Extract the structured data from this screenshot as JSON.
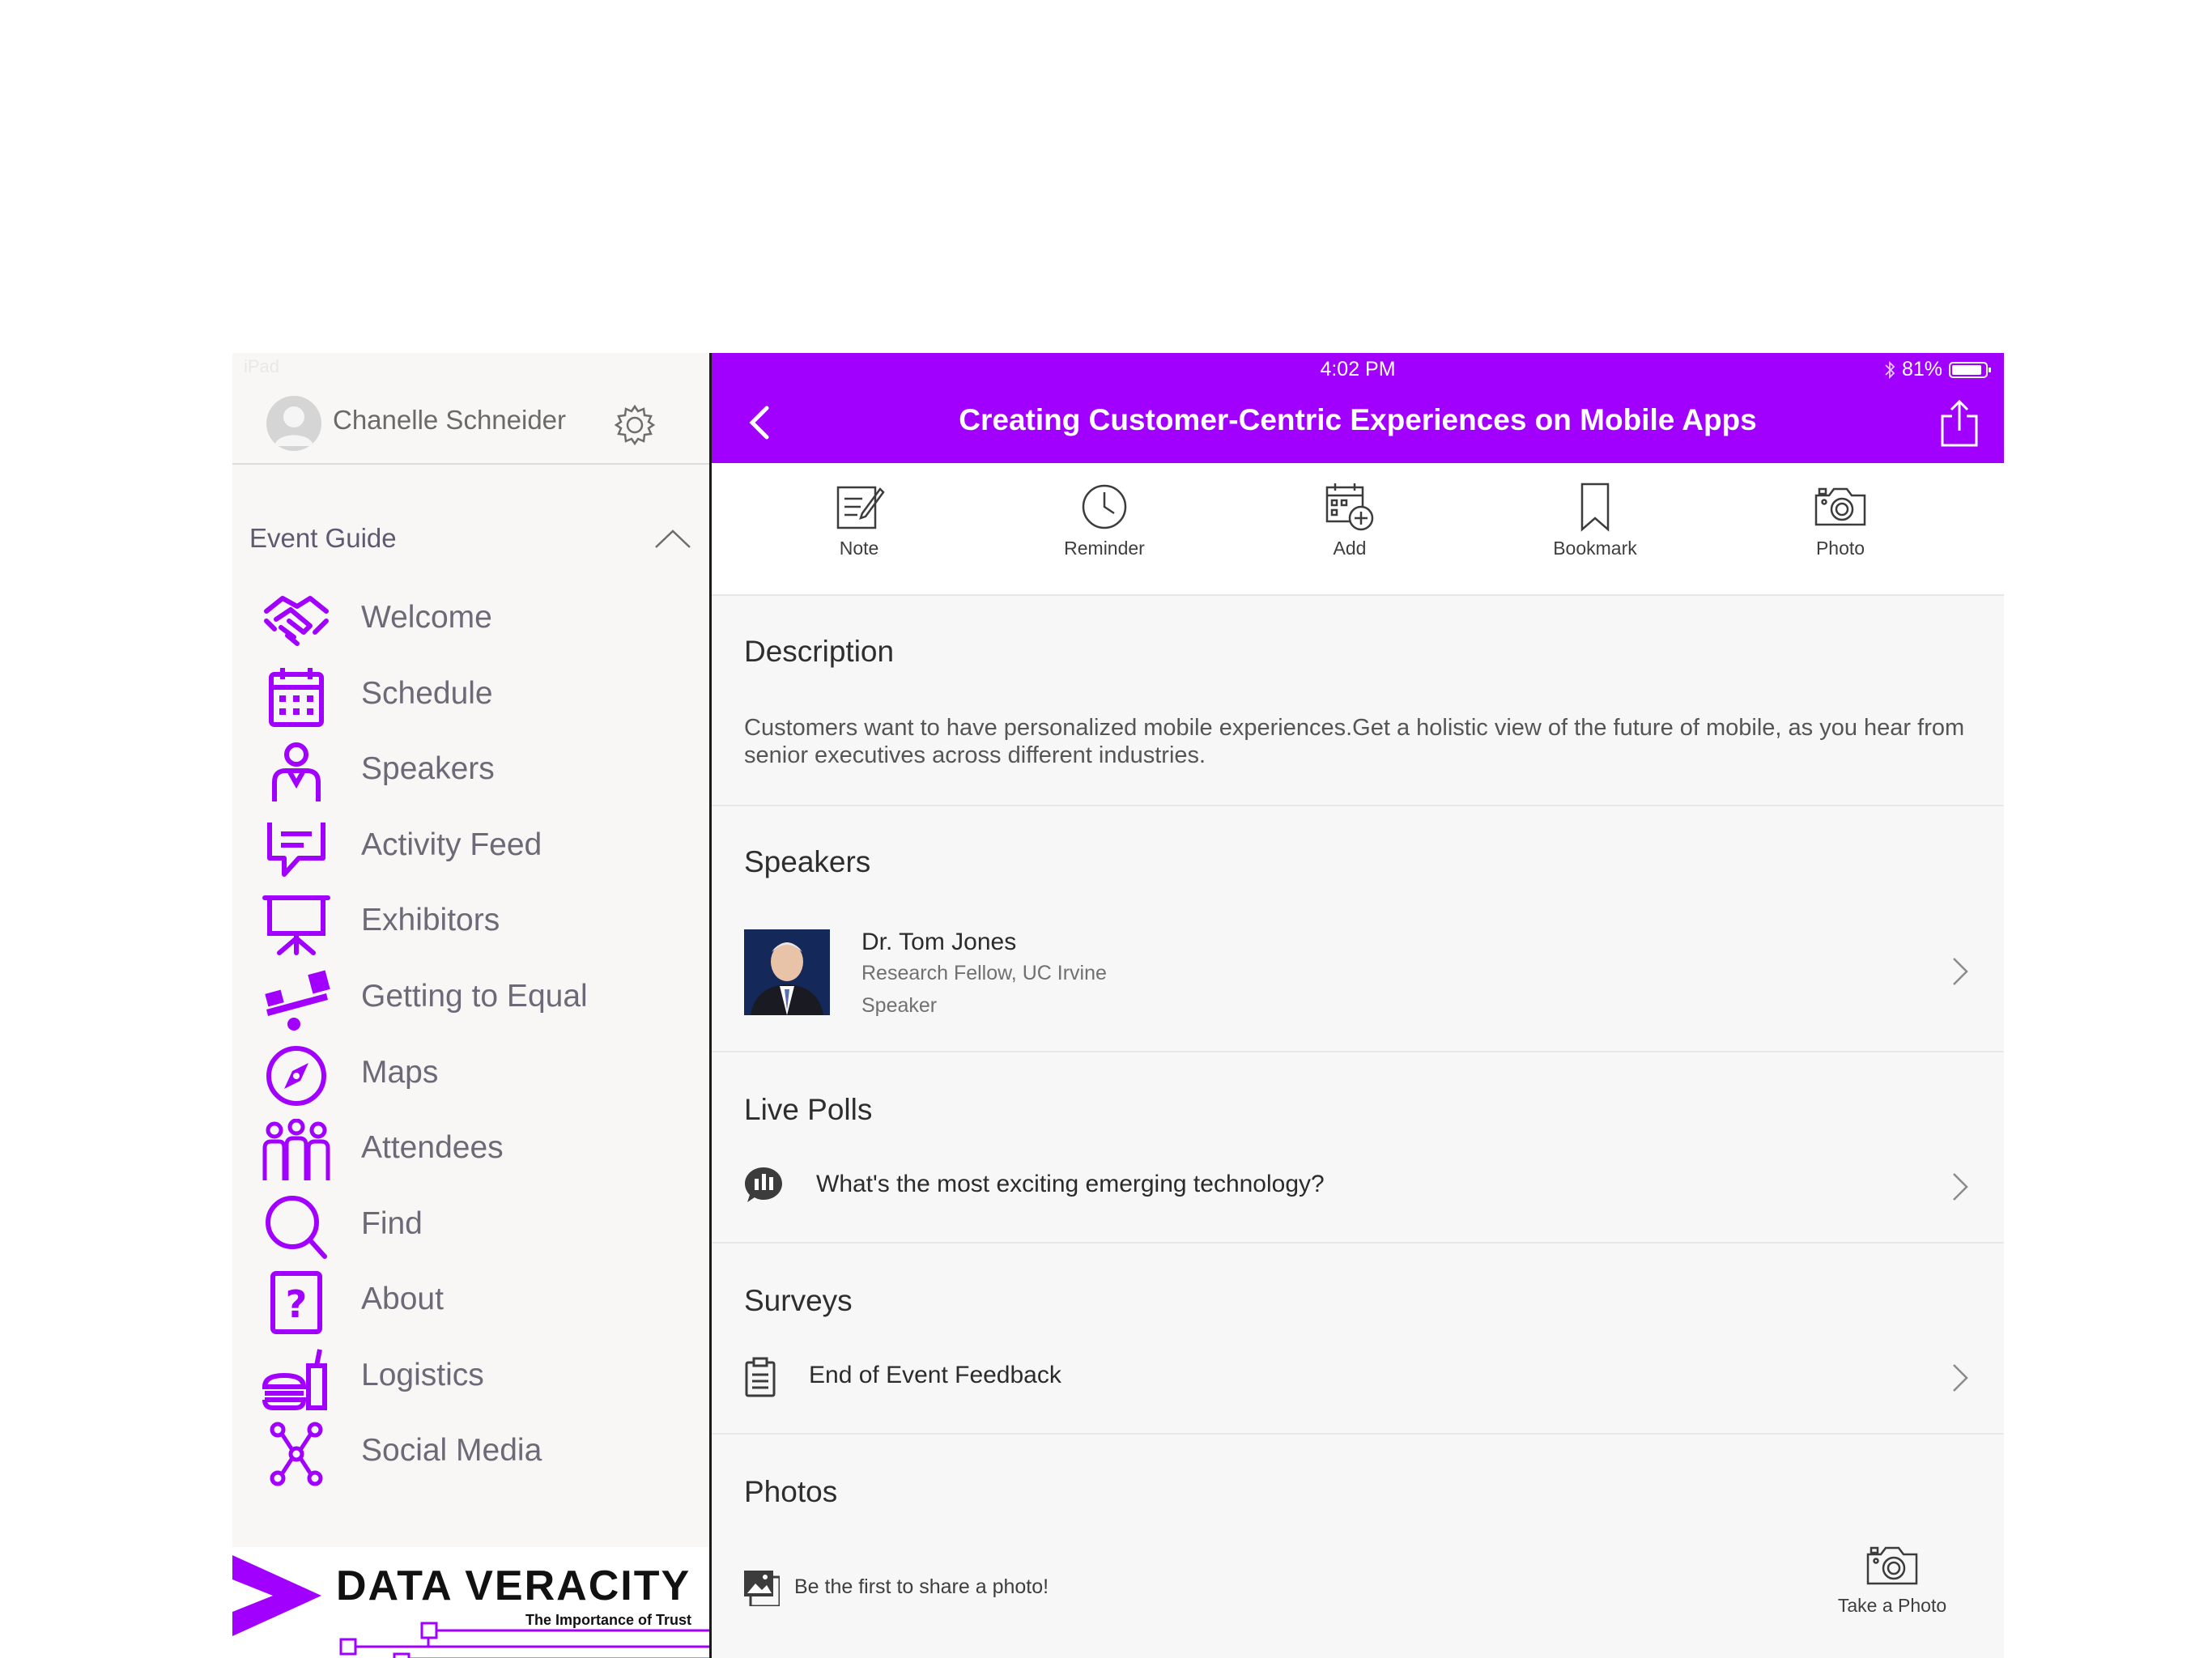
{
  "sidebar": {
    "status": "iPad",
    "user_name": "Chanelle Schneider",
    "section_title": "Event Guide",
    "accent": "#a100ff",
    "items": [
      {
        "label": "Welcome",
        "icon": "handshake-icon"
      },
      {
        "label": "Schedule",
        "icon": "calendar-icon"
      },
      {
        "label": "Speakers",
        "icon": "person-icon"
      },
      {
        "label": "Activity Feed",
        "icon": "chat-icon"
      },
      {
        "label": "Exhibitors",
        "icon": "presentation-icon"
      },
      {
        "label": "Getting to Equal",
        "icon": "seesaw-icon"
      },
      {
        "label": "Maps",
        "icon": "compass-icon"
      },
      {
        "label": "Attendees",
        "icon": "group-icon"
      },
      {
        "label": "Find",
        "icon": "search-icon"
      },
      {
        "label": "About",
        "icon": "question-icon"
      },
      {
        "label": "Logistics",
        "icon": "food-icon"
      },
      {
        "label": "Social Media",
        "icon": "network-icon"
      }
    ],
    "banner": {
      "title": "DATA VERACITY",
      "subtitle": "The Importance of Trust"
    }
  },
  "status_bar": {
    "time": "4:02 PM",
    "battery": "81%"
  },
  "header": {
    "title": "Creating Customer-Centric Experiences on Mobile Apps",
    "bg_color": "#a100ff"
  },
  "actions": [
    {
      "label": "Note",
      "icon": "note-icon"
    },
    {
      "label": "Reminder",
      "icon": "clock-icon"
    },
    {
      "label": "Add",
      "icon": "calendar-add-icon"
    },
    {
      "label": "Bookmark",
      "icon": "bookmark-icon"
    },
    {
      "label": "Photo",
      "icon": "camera-icon"
    }
  ],
  "description": {
    "title": "Description",
    "text": "Customers want to have personalized mobile experiences.Get a holistic view of the future of mobile, as you hear from senior executives across different industries."
  },
  "speakers": {
    "title": "Speakers",
    "items": [
      {
        "name": "Dr. Tom Jones",
        "affiliation": "Research Fellow, UC Irvine",
        "role": "Speaker"
      }
    ]
  },
  "live_polls": {
    "title": "Live Polls",
    "items": [
      {
        "question": "What's the most exciting emerging technology?"
      }
    ]
  },
  "surveys": {
    "title": "Surveys",
    "items": [
      {
        "label": "End of Event Feedback"
      }
    ]
  },
  "photos": {
    "title": "Photos",
    "empty_text": "Be the first to share a photo!",
    "take_photo_label": "Take a Photo"
  }
}
